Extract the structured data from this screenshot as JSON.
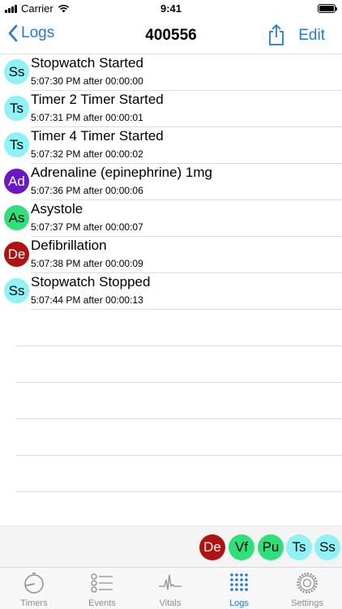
{
  "status_bar": {
    "carrier": "Carrier",
    "time": "9:41"
  },
  "nav": {
    "back_label": "Logs",
    "title": "400556",
    "edit_label": "Edit"
  },
  "logs": [
    {
      "abbr": "Ss",
      "color": "#8ff3f5",
      "title": "Stopwatch Started",
      "subtitle": "5:07:30 PM after 00:00:00"
    },
    {
      "abbr": "Ts",
      "color": "#8ff3f5",
      "title": "Timer 2 Timer Started",
      "subtitle": "5:07:31 PM after 00:00:01"
    },
    {
      "abbr": "Ts",
      "color": "#8ff3f5",
      "title": "Timer 4 Timer Started",
      "subtitle": "5:07:32 PM after 00:00:02"
    },
    {
      "abbr": "Ad",
      "color": "#6a16c9",
      "text_color": "#ffffff",
      "title": "Adrenaline (epinephrine) 1mg",
      "subtitle": "5:07:36 PM after 00:00:06"
    },
    {
      "abbr": "As",
      "color": "#2ee07a",
      "title": "Asystole",
      "subtitle": "5:07:37 PM after 00:00:07"
    },
    {
      "abbr": "De",
      "color": "#b01212",
      "text_color": "#ffffff",
      "title": "Defibrillation",
      "subtitle": "5:07:38 PM after 00:00:09"
    },
    {
      "abbr": "Ss",
      "color": "#8ff3f5",
      "title": "Stopwatch Stopped",
      "subtitle": "5:07:44 PM after 00:00:13"
    }
  ],
  "quick_buttons": [
    {
      "abbr": "De",
      "color": "#b01212",
      "text_color": "#ffffff"
    },
    {
      "abbr": "Vf",
      "color": "#2ee07a"
    },
    {
      "abbr": "Pu",
      "color": "#2ee07a"
    },
    {
      "abbr": "Ts",
      "color": "#8ff3f5"
    },
    {
      "abbr": "Ss",
      "color": "#8ff3f5"
    }
  ],
  "tabs": [
    {
      "label": "Timers",
      "icon": "stopwatch-icon"
    },
    {
      "label": "Events",
      "icon": "list-icon"
    },
    {
      "label": "Vitals",
      "icon": "waveform-icon"
    },
    {
      "label": "Logs",
      "icon": "dot-grid-icon",
      "active": true
    },
    {
      "label": "Settings",
      "icon": "gear-icon"
    }
  ],
  "colors": {
    "accent": "#1f7ae0",
    "inactive": "#8e8e93"
  }
}
